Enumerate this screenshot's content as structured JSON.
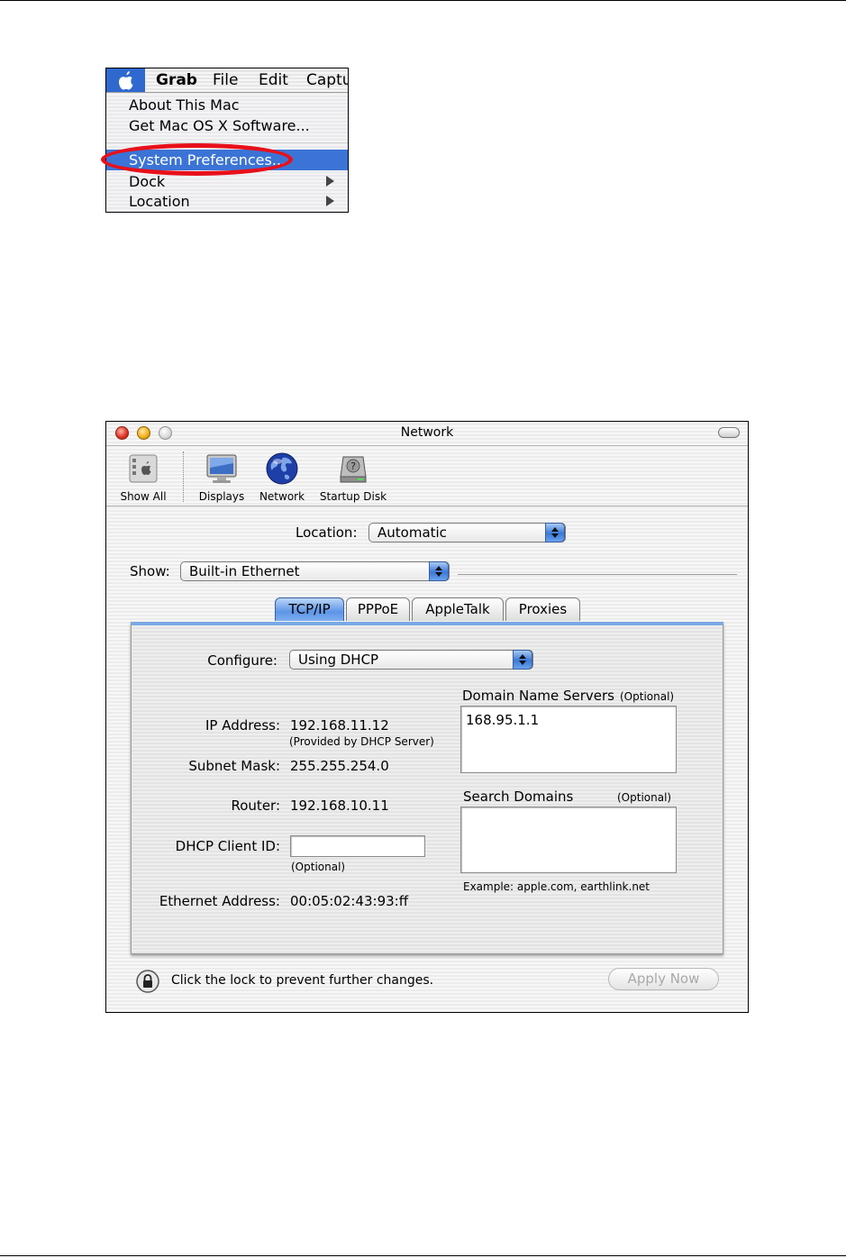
{
  "apple_menu": {
    "menubar": [
      "Grab",
      "File",
      "Edit",
      "Captu"
    ],
    "items": {
      "about": "About This Mac",
      "get_software": "Get Mac OS X Software...",
      "system_preferences": "System Preferences...",
      "dock": "Dock",
      "location": "Location"
    },
    "highlight_color": "#3b74d6",
    "annotation_color": "#e8101a"
  },
  "window": {
    "title": "Network",
    "toolbar": [
      {
        "label": "Show All",
        "icon": "show-all-icon"
      },
      {
        "label": "Displays",
        "icon": "display-icon"
      },
      {
        "label": "Network",
        "icon": "globe-icon"
      },
      {
        "label": "Startup Disk",
        "icon": "hard-disk-icon"
      }
    ],
    "location": {
      "label": "Location:",
      "value": "Automatic"
    },
    "show": {
      "label": "Show:",
      "value": "Built-in Ethernet"
    },
    "tabs": [
      {
        "label": "TCP/IP",
        "active": true
      },
      {
        "label": "PPPoE",
        "active": false
      },
      {
        "label": "AppleTalk",
        "active": false
      },
      {
        "label": "Proxies",
        "active": false
      }
    ],
    "tcpip": {
      "configure_label": "Configure:",
      "configure_value": "Using DHCP",
      "ip_label": "IP Address:",
      "ip_value": "192.168.11.12",
      "ip_note": "(Provided by DHCP Server)",
      "subnet_label": "Subnet Mask:",
      "subnet_value": "255.255.254.0",
      "router_label": "Router:",
      "router_value": "192.168.10.11",
      "dhcp_label": "DHCP Client ID:",
      "dhcp_value": "",
      "dhcp_note": "(Optional)",
      "ethernet_label": "Ethernet Address:",
      "ethernet_value": "00:05:02:43:93:ff",
      "dns_label": "Domain Name Servers",
      "dns_optional": "(Optional)",
      "dns_value": "168.95.1.1",
      "search_label": "Search Domains",
      "search_optional": "(Optional)",
      "search_value": "",
      "search_example": "Example: apple.com, earthlink.net"
    },
    "footer": {
      "lock_text": "Click the lock to prevent further changes.",
      "apply_label": "Apply Now"
    },
    "accent_color": "#3b79d8"
  }
}
